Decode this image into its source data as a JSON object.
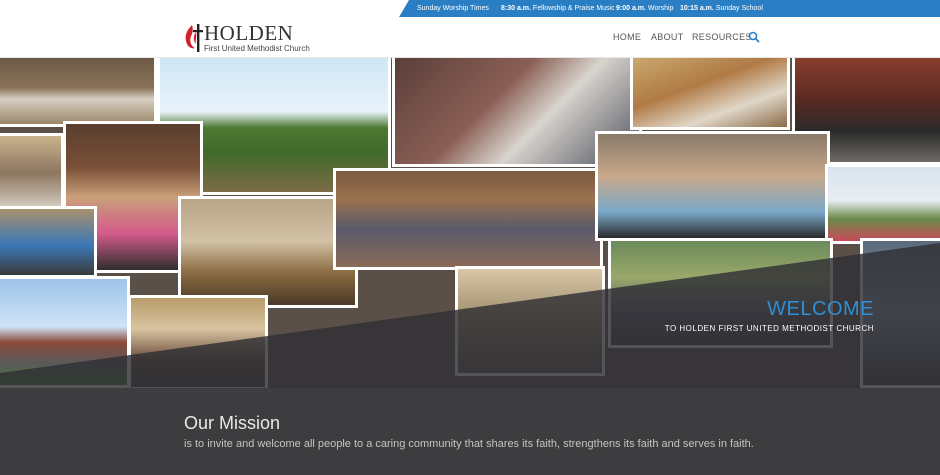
{
  "topbar": {
    "label": "Sunday Worship Times",
    "services": [
      {
        "time": "8:30 a.m.",
        "name": "Fellowship & Praise Music"
      },
      {
        "time": "9:00 a.m.",
        "name": "Worship"
      },
      {
        "time": "10:15 a.m.",
        "name": "Sunday School"
      }
    ]
  },
  "logo": {
    "title": "HOLDEN",
    "subtitle": "First United Methodist Church"
  },
  "nav": {
    "items": [
      "HOME",
      "ABOUT",
      "RESOURCES"
    ]
  },
  "hero": {
    "title": "WELCOME",
    "subtitle": "TO HOLDEN FIRST UNITED METHODIST CHURCH"
  },
  "mission": {
    "title": "Our Mission",
    "text": "is to invite and welcome all people to a caring community that shares its faith, strengthens its faith and serves in faith."
  },
  "colors": {
    "accent": "#2a7fc4",
    "welcome": "#2f8fd6",
    "band": "#3d3d3f"
  },
  "icons": {
    "search": "search-icon",
    "logo": "cross-and-flame-icon"
  }
}
